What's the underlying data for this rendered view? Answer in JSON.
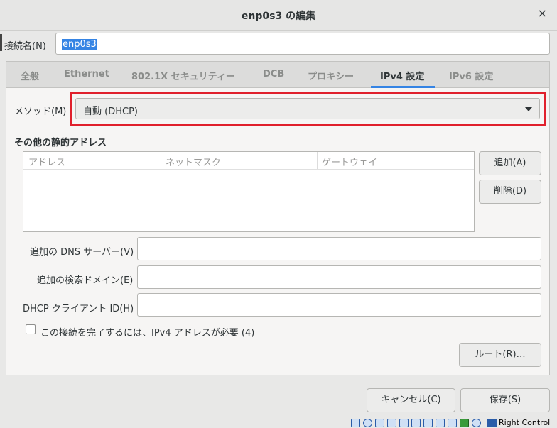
{
  "window": {
    "title": "enp0s3 の編集",
    "close_glyph": "×"
  },
  "connection": {
    "label": "接続名(N)",
    "value": "enp0s3"
  },
  "tabs": [
    {
      "label": "全般"
    },
    {
      "label": "Ethernet"
    },
    {
      "label": "802.1X セキュリティー"
    },
    {
      "label": "DCB"
    },
    {
      "label": "プロキシー"
    },
    {
      "label": "IPv4 設定",
      "active": true
    },
    {
      "label": "IPv6 設定"
    }
  ],
  "ipv4": {
    "method_label": "メソッド(M)",
    "method_value": "自動 (DHCP)",
    "section_title": "その他の静的アドレス",
    "columns": [
      "アドレス",
      "ネットマスク",
      "ゲートウェイ"
    ],
    "add_button": "追加(A)",
    "delete_button": "削除(D)",
    "dns_label": "追加の DNS サーバー(V)",
    "dns_value": "",
    "search_label": "追加の検索ドメイン(E)",
    "search_value": "",
    "dhcp_label": "DHCP クライアント ID(H)",
    "dhcp_value": "",
    "require_label": "この接続を完了するには、IPv4 アドレスが必要 (4)",
    "require_checked": false,
    "routes_button": "ルート(R)…"
  },
  "footer": {
    "cancel": "キャンセル(C)",
    "save": "保存(S)"
  },
  "statusbar": {
    "host_key": "Right Control"
  },
  "colors": {
    "highlight": "#e0202c",
    "accent": "#3584e4"
  }
}
